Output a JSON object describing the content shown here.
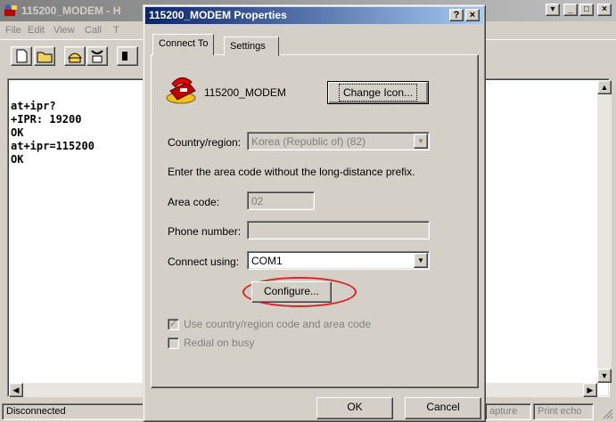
{
  "terminal": {
    "title": "115200_MODEM - H",
    "menu": [
      "File",
      "Edit",
      "View",
      "Call",
      "T"
    ],
    "lines": [
      "at+ipr?",
      "+IPR: 19200",
      "",
      "OK",
      "at+ipr=115200",
      "OK"
    ],
    "status": {
      "connection": "Disconnected",
      "capture": "apture",
      "print_echo": "Print echo"
    }
  },
  "dialog": {
    "title": "115200_MODEM Properties",
    "help_btn": "?",
    "close_btn": "×",
    "tabs": [
      "Connect To",
      "Settings"
    ],
    "modem_name": "115200_MODEM",
    "change_icon_label": "Change Icon...",
    "country_label": "Country/region:",
    "country_value": "Korea (Republic of) (82)",
    "area_hint": "Enter the area code without the long-distance prefix.",
    "area_code_label": "Area code:",
    "area_code_value": "02",
    "phone_label": "Phone number:",
    "phone_value": "",
    "connect_using_label": "Connect using:",
    "connect_using_value": "COM1",
    "configure_label": "Configure...",
    "use_country_label": "Use country/region code and area code",
    "use_country_checked": true,
    "redial_label": "Redial on busy",
    "redial_checked": false,
    "ok_label": "OK",
    "cancel_label": "Cancel"
  },
  "colors": {
    "active_title": "#0a246a",
    "inactive_title": "#808080",
    "face": "#d4d0c8",
    "highlight_ring": "#e02020"
  }
}
